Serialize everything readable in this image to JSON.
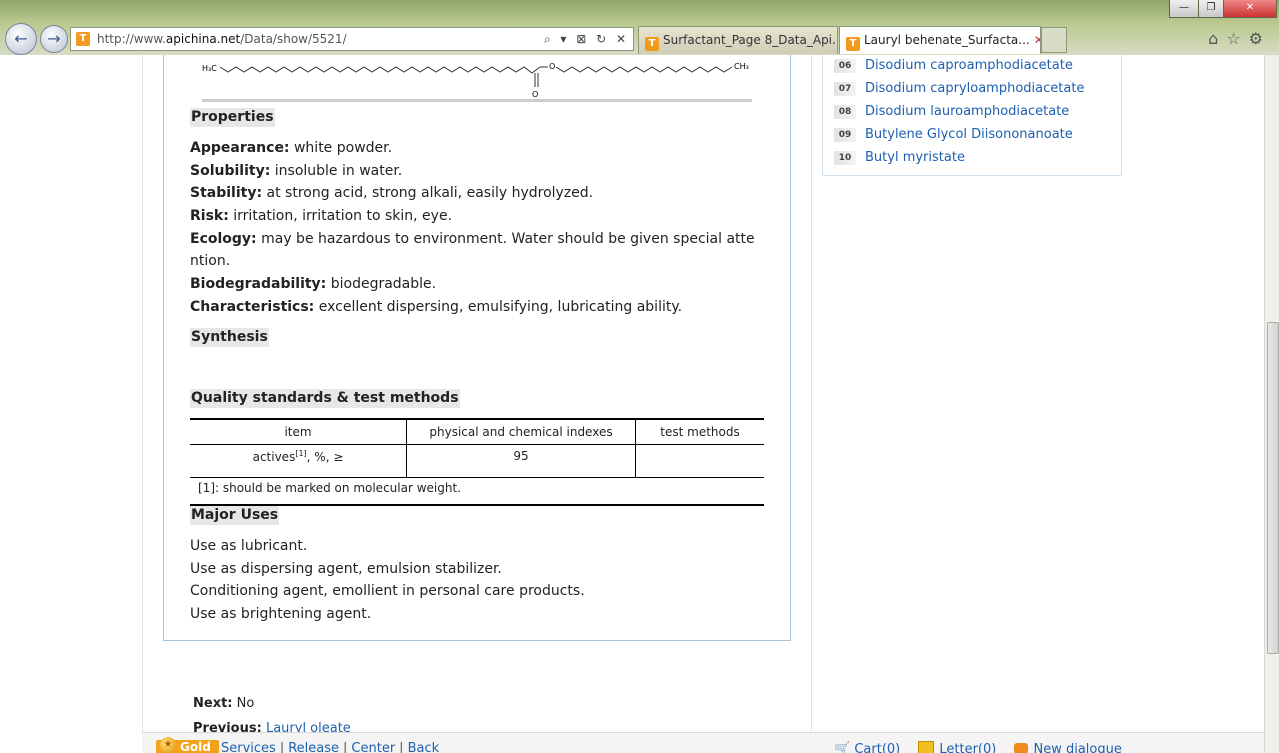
{
  "browser": {
    "url_prefix": "http://www.",
    "url_domain": "apichina.net",
    "url_path": "/Data/show/5521/",
    "address_tools": "⌕ ▾ ⊠ ↻ ✕",
    "tabs": [
      {
        "label": "Surfactant_Page 8_Data_Api..."
      },
      {
        "label": "Lauryl behenate_Surfacta...",
        "close": "✕"
      }
    ],
    "window_buttons": {
      "minimize": "—",
      "restore": "❐",
      "close": "✕"
    },
    "right_icons": "⌂☆⚙"
  },
  "formula": {
    "left_label": "H₃C",
    "right_label": "CH₃",
    "oxygen_label": "O",
    "carbonyl_label": "O"
  },
  "sections": {
    "properties": "Properties",
    "synthesis": "Synthesis",
    "quality": "Quality standards & test methods",
    "uses": "Major Uses"
  },
  "properties": [
    {
      "label": "Appearance:",
      "text": " white powder."
    },
    {
      "label": "Solubility:",
      "text": " insoluble in water."
    },
    {
      "label": "Stability:",
      "text": " at strong acid, strong alkali, easily hydrolyzed."
    },
    {
      "label": "Risk:",
      "text": " irritation, irritation to skin, eye."
    },
    {
      "label": "Ecology:",
      "text": " may be hazardous to environment. Water should be given special atte"
    },
    {
      "label": "",
      "text": "ntion."
    },
    {
      "label": "Biodegradability:",
      "text": " biodegradable."
    },
    {
      "label": "Characteristics:",
      "text": " excellent dispersing, emulsifying, lubricating ability."
    }
  ],
  "table": {
    "headers": [
      "item",
      "physical and chemical indexes",
      "test methods"
    ],
    "row": {
      "item": "actives",
      "sup": "[1]",
      "item_suffix": ", %, ≥",
      "value": "95",
      "method": ""
    },
    "note": "[1]: should be marked on molecular weight."
  },
  "uses": [
    "Use as lubricant.",
    "Use as dispersing agent, emulsion stabilizer.",
    "Conditioning agent, emollient in personal care products.",
    "Use as brightening agent."
  ],
  "navigation": {
    "next_label": "Next:",
    "next_value": "No",
    "previous_label": "Previous:",
    "previous_value": "Lauryl oleate"
  },
  "sidebar": [
    {
      "num": "06",
      "label": "Disodium caproamphodiacetate"
    },
    {
      "num": "07",
      "label": "Disodium capryloamphodiacetate"
    },
    {
      "num": "08",
      "label": "Disodium lauroamphodiacetate"
    },
    {
      "num": "09",
      "label": "Butylene Glycol Diisononanoate"
    },
    {
      "num": "10",
      "label": "Butyl myristate"
    }
  ],
  "bottom": {
    "gold": "Gold",
    "links": [
      "Services",
      "Release",
      "Center",
      "Back"
    ],
    "cart": "Cart(0)",
    "letter": "Letter(0)",
    "dialogue": "New dialogue"
  }
}
